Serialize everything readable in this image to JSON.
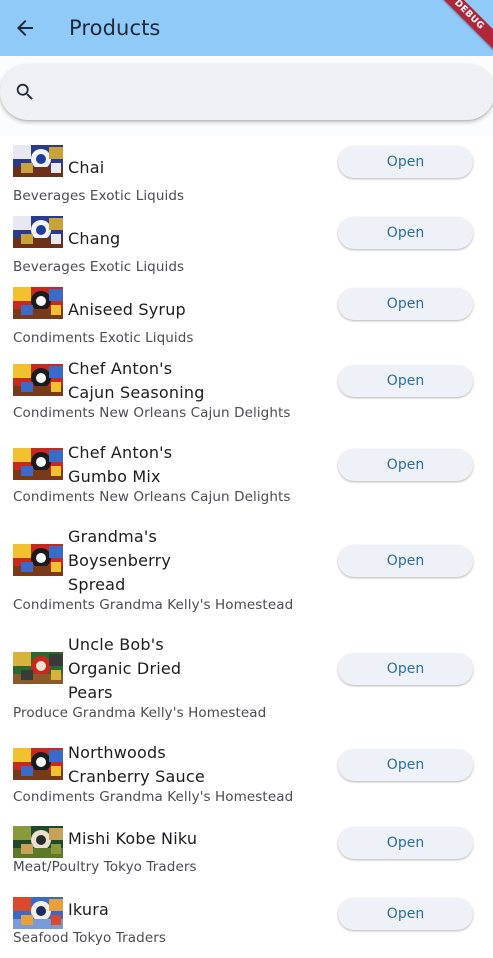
{
  "appbar": {
    "title": "Products",
    "debug_label": "DEBUG"
  },
  "search": {
    "placeholder": "",
    "value": ""
  },
  "products": [
    {
      "name": "Chai",
      "sub": "Beverages Exotic Liquids",
      "button": "Open",
      "img": "a"
    },
    {
      "name": "Chang",
      "sub": "Beverages Exotic Liquids",
      "button": "Open",
      "img": "a"
    },
    {
      "name": "Aniseed Syrup",
      "sub": "Condiments Exotic Liquids",
      "button": "Open",
      "img": "b"
    },
    {
      "name": "Chef Anton's\nCajun Seasoning",
      "sub": "Condiments New Orleans Cajun Delights",
      "button": "Open",
      "img": "b"
    },
    {
      "name": "Chef Anton's\nGumbo Mix",
      "sub": "Condiments New Orleans Cajun Delights",
      "button": "Open",
      "img": "b"
    },
    {
      "name": "Grandma's\nBoysenberry\nSpread",
      "sub": "Condiments Grandma Kelly's Homestead",
      "button": "Open",
      "img": "b"
    },
    {
      "name": "Uncle Bob's\nOrganic Dried\nPears",
      "sub": "Produce Grandma Kelly's Homestead",
      "button": "Open",
      "img": "c"
    },
    {
      "name": "Northwoods\nCranberry Sauce",
      "sub": "Condiments Grandma Kelly's Homestead",
      "button": "Open",
      "img": "b"
    },
    {
      "name": "Mishi Kobe Niku",
      "sub": "Meat/Poultry Tokyo Traders",
      "button": "Open",
      "img": "d"
    },
    {
      "name": "Ikura",
      "sub": "Seafood Tokyo Traders",
      "button": "Open",
      "img": "e"
    }
  ]
}
